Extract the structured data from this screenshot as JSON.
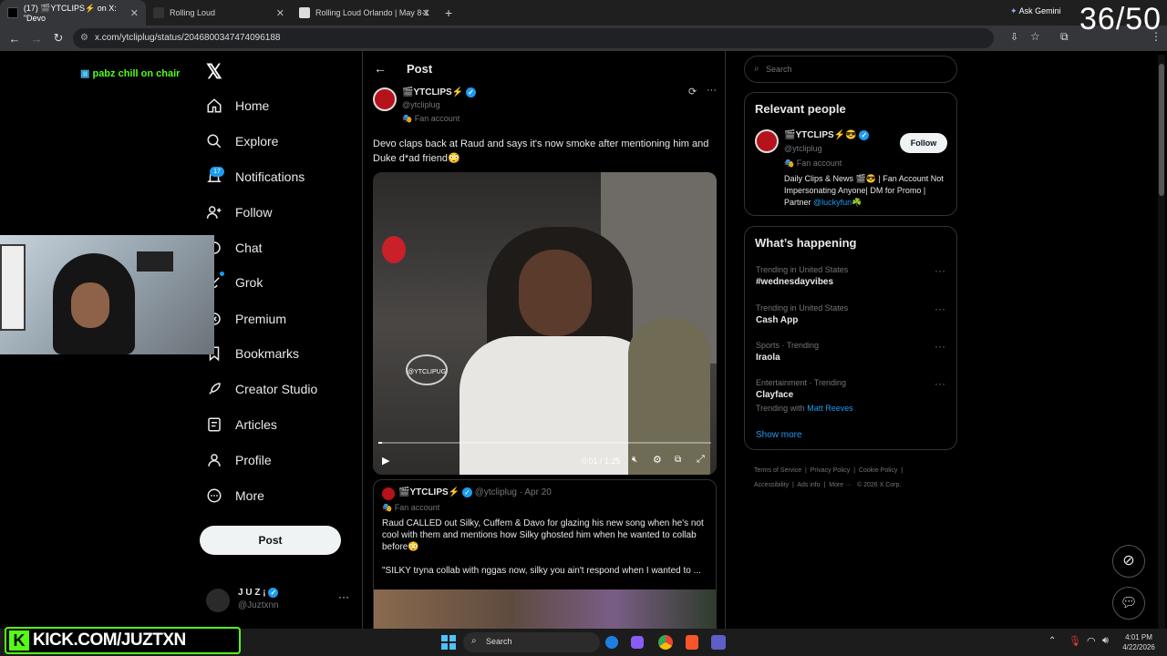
{
  "browser": {
    "tabs": [
      {
        "title": "(17) 🎬YTCLIPS⚡ on X: \"Devo",
        "active": true
      },
      {
        "title": "Rolling Loud",
        "active": false
      },
      {
        "title": "Rolling Loud Orlando | May 8-1",
        "active": false
      }
    ],
    "ask_gemini": "Ask Gemini",
    "url": "x.com/ytcliplug/status/2046800347474096188"
  },
  "overlay": {
    "counter": "36/50",
    "stream_title": "pabz  chill on chair",
    "kick_banner": "KICK.COM/JUZTXN"
  },
  "nav": {
    "items": [
      {
        "label": "Home",
        "icon": "home-icon"
      },
      {
        "label": "Explore",
        "icon": "search-icon"
      },
      {
        "label": "Notifications",
        "icon": "bell-icon",
        "badge": "17"
      },
      {
        "label": "Follow",
        "icon": "add-person-icon"
      },
      {
        "label": "Chat",
        "icon": "chat-icon"
      },
      {
        "label": "Grok",
        "icon": "grok-icon"
      },
      {
        "label": "Premium",
        "icon": "x-premium-icon"
      },
      {
        "label": "Bookmarks",
        "icon": "bookmark-icon"
      },
      {
        "label": "Creator Studio",
        "icon": "rocket-icon"
      },
      {
        "label": "Articles",
        "icon": "article-icon"
      },
      {
        "label": "Profile",
        "icon": "person-icon"
      },
      {
        "label": "More",
        "icon": "more-circle-icon"
      }
    ],
    "post_button": "Post",
    "account": {
      "name": "J U Z ¡",
      "handle": "@Juztxnn"
    }
  },
  "post": {
    "header": "Post",
    "author": {
      "name": "🎬YTCLIPS⚡",
      "handle": "@ytcliplug",
      "label": "Fan account"
    },
    "text": "Devo claps back at Raud and says it's now smoke after mentioning him and Duke d*ad friend😳",
    "video": {
      "watermark": "@YTCLIPUG",
      "time": "0:01 / 1:25",
      "progress": 0.01
    }
  },
  "quoted": {
    "author": "🎬YTCLIPS⚡",
    "handle": "@ytcliplug",
    "date": "Apr 20",
    "label": "Fan account",
    "text": "Raud CALLED out Silky, Cuffem & Davo for glazing his new song when he's not cool with them and mentions how Silky ghosted him when he wanted to collab before😳",
    "quote": "\"SILKY tryna collab with nggas now, silky you ain't respond when I wanted to ..."
  },
  "right": {
    "search_placeholder": "Search",
    "relevant_title": "Relevant people",
    "person": {
      "name": "🎬YTCLIPS⚡😎",
      "handle": "@ytcliplug",
      "label": "Fan account",
      "bio": "Daily Clips & News 🎬😎 | Fan Account Not Impersonating Anyone| DM for Promo | Partner",
      "bio_link": "@luckyfun",
      "bio_end": "☘️",
      "follow": "Follow"
    },
    "happening_title": "What’s happening",
    "trends": [
      {
        "meta": "Trending in United States",
        "title": "#wednesdayvibes"
      },
      {
        "meta": "Trending in United States",
        "title": "Cash App"
      },
      {
        "meta": "Sports · Trending",
        "title": "Iraola"
      },
      {
        "meta": "Entertainment · Trending",
        "title": "Clayface",
        "extra_prefix": "Trending with",
        "extra_link": "Matt Reeves"
      }
    ],
    "show_more": "Show more",
    "footer": [
      "Terms of Service",
      "Privacy Policy",
      "Cookie Policy",
      "Accessibility",
      "Ads info",
      "More ···",
      "© 2026 X Corp."
    ]
  },
  "taskbar": {
    "search": "Search",
    "time": "4:01 PM",
    "date": "4/22/2026"
  },
  "colors": {
    "accent": "#1d9bf0",
    "bg": "#000000",
    "border": "#2f3336",
    "kick_green": "#53fc18"
  }
}
